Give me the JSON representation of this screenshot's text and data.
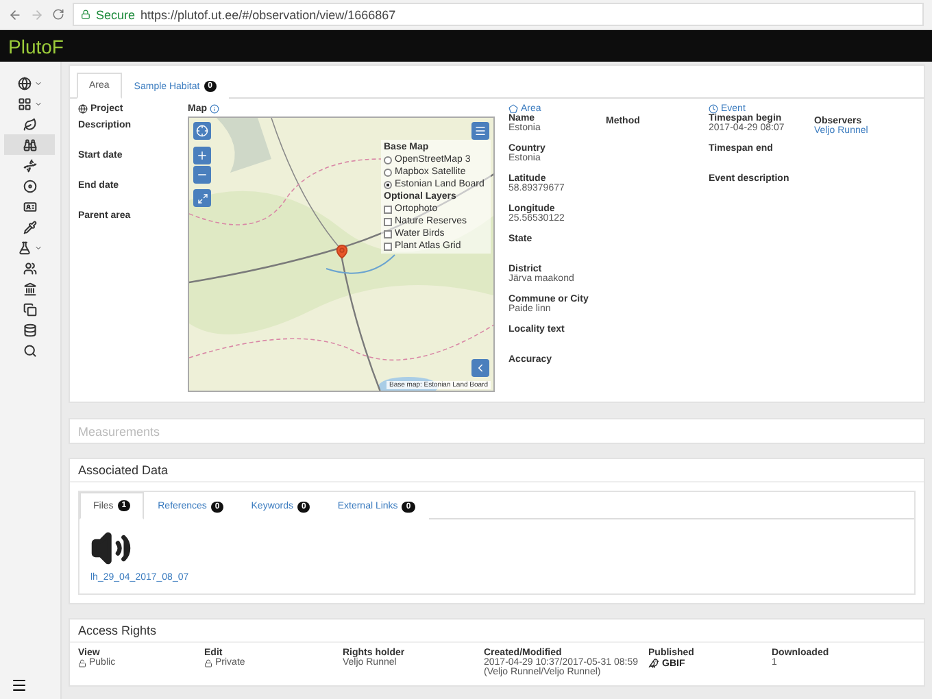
{
  "browser": {
    "secure_label": "Secure",
    "url": "https://plutof.ut.ee/#/observation/view/1666867"
  },
  "app_title": "PlutoF",
  "sidebar": {
    "items": [
      {
        "has_dropdown": true,
        "selected": false
      },
      {
        "has_dropdown": true,
        "selected": false
      },
      {
        "has_dropdown": false,
        "selected": false
      },
      {
        "has_dropdown": false,
        "selected": true
      },
      {
        "has_dropdown": false,
        "selected": false
      },
      {
        "has_dropdown": false,
        "selected": false
      },
      {
        "has_dropdown": false,
        "selected": false
      },
      {
        "has_dropdown": false,
        "selected": false
      },
      {
        "has_dropdown": true,
        "selected": false
      },
      {
        "has_dropdown": false,
        "selected": false
      },
      {
        "has_dropdown": false,
        "selected": false
      },
      {
        "has_dropdown": false,
        "selected": false
      },
      {
        "has_dropdown": false,
        "selected": false
      },
      {
        "has_dropdown": false,
        "selected": false
      }
    ]
  },
  "tabs": [
    {
      "label": "Area",
      "selected": true
    },
    {
      "label": "Sample Habitat",
      "badge": "0",
      "selected": false
    }
  ],
  "left_fields": [
    "Project",
    "Description",
    "Start date",
    "End date",
    "Parent area"
  ],
  "map": {
    "label": "Map",
    "base_map_title": "Base Map",
    "base_layers": [
      {
        "label": "OpenStreetMap 3",
        "selected": false
      },
      {
        "label": "Mapbox Satellite",
        "selected": false
      },
      {
        "label": "Estonian Land Board",
        "selected": true
      }
    ],
    "optional_title": "Optional Layers",
    "optional_layers": [
      {
        "label": "Ortophoto",
        "checked": false
      },
      {
        "label": "Nature Reserves",
        "checked": false
      },
      {
        "label": "Water Birds",
        "checked": false
      },
      {
        "label": "Plant Atlas Grid",
        "checked": false
      }
    ],
    "attribution": "Base map: Estonian Land Board"
  },
  "area": {
    "title": "Area",
    "fields": [
      {
        "label": "Name",
        "value": "Estonia"
      },
      {
        "label": "Country",
        "value": "Estonia"
      },
      {
        "label": "Latitude",
        "value": "58.89379677"
      },
      {
        "label": "Longitude",
        "value": "25.56530122"
      },
      {
        "label": "State"
      },
      {
        "label": "District",
        "value": "Järva maakond"
      },
      {
        "label": "Commune or City",
        "value": "Paide linn"
      },
      {
        "label": "Locality text"
      },
      {
        "label": "Accuracy"
      }
    ]
  },
  "method_label": "Method",
  "event": {
    "title": "Event",
    "fields": [
      {
        "label": "Timespan begin",
        "value": "2017-04-29 08:07"
      },
      {
        "label": "Timespan end"
      },
      {
        "label": "Event description"
      }
    ]
  },
  "observers": {
    "label": "Observers",
    "value": "Veljo Runnel"
  },
  "measurements_title": "Measurements",
  "associated": {
    "title": "Associated Data",
    "tabs": [
      {
        "label": "Files",
        "badge": "1",
        "selected": true
      },
      {
        "label": "References",
        "badge": "0",
        "selected": false
      },
      {
        "label": "Keywords",
        "badge": "0",
        "selected": false
      },
      {
        "label": "External Links",
        "badge": "0",
        "selected": false
      }
    ],
    "files": [
      {
        "name": "lh_29_04_2017_08_07"
      }
    ]
  },
  "access": {
    "title": "Access Rights",
    "columns": [
      {
        "kind": "lock",
        "label": "View",
        "value": "Public",
        "locked": false
      },
      {
        "kind": "lock",
        "label": "Edit",
        "value": "Private",
        "locked": true
      },
      {
        "kind": "text",
        "label": "Rights holder",
        "value": "Veljo Runnel"
      },
      {
        "kind": "text",
        "label": "Created/Modified",
        "value": "2017-04-29 10:37/2017-05-31 08:59",
        "value2": "(Veljo Runnel/Veljo Runnel)"
      },
      {
        "kind": "gbif",
        "label": "Published",
        "value": "GBIF"
      },
      {
        "kind": "text",
        "label": "Downloaded",
        "value": "1"
      }
    ]
  }
}
